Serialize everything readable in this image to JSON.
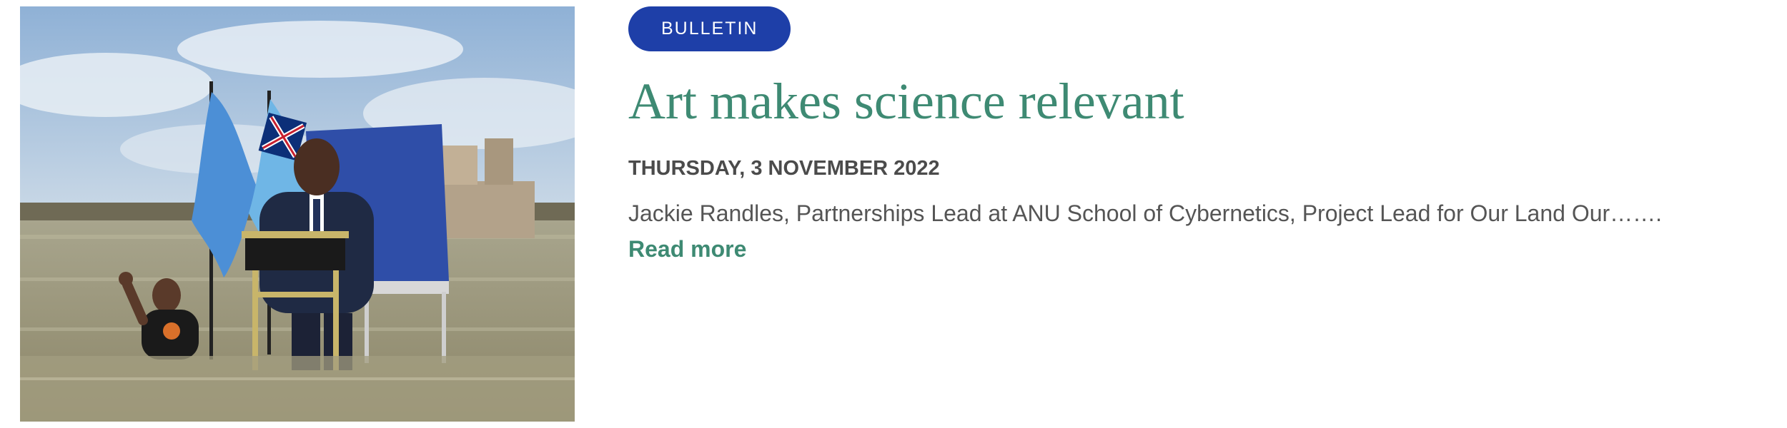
{
  "post": {
    "category": "BULLETIN",
    "title": "Art makes science relevant",
    "date": "THURSDAY, 3 NOVEMBER 2022",
    "excerpt": "Jackie Randles, Partnerships Lead at ANU School of Cybernetics, Project Lead for Our Land Our…….",
    "read_more": "Read more",
    "image_alt": "Speaker at a lectern standing in shallow sea water in front of flags, with a person waving in the water nearby"
  },
  "colors": {
    "badge_bg": "#1e3fa8",
    "title": "#3e8a73",
    "date": "#4b4b4b",
    "excerpt": "#555555",
    "link": "#3e8a73"
  }
}
